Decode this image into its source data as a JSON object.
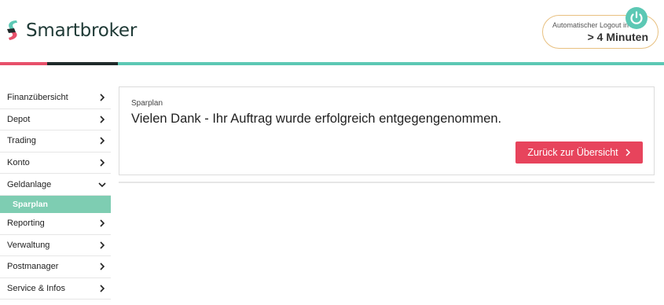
{
  "brand": {
    "name": "Smartbroker"
  },
  "logout": {
    "label": "Automatischer Logout in",
    "value": "> 4 Minuten"
  },
  "sidebar": {
    "items": [
      {
        "label": "Finanzübersicht"
      },
      {
        "label": "Depot"
      },
      {
        "label": "Trading"
      },
      {
        "label": "Konto"
      },
      {
        "label": "Geldanlage"
      },
      {
        "label": "Sparplan"
      },
      {
        "label": "Reporting"
      },
      {
        "label": "Verwaltung"
      },
      {
        "label": "Postmanager"
      },
      {
        "label": "Service & Infos"
      }
    ]
  },
  "main": {
    "subtitle": "Sparplan",
    "message": "Vielen Dank - Ihr Auftrag wurde erfolgreich entgegengenommen.",
    "back_button": "Zurück zur Übersicht"
  },
  "colors": {
    "accent_red": "#e7445c",
    "teal": "#5cc8b4",
    "active_green": "#7ecdb2"
  }
}
